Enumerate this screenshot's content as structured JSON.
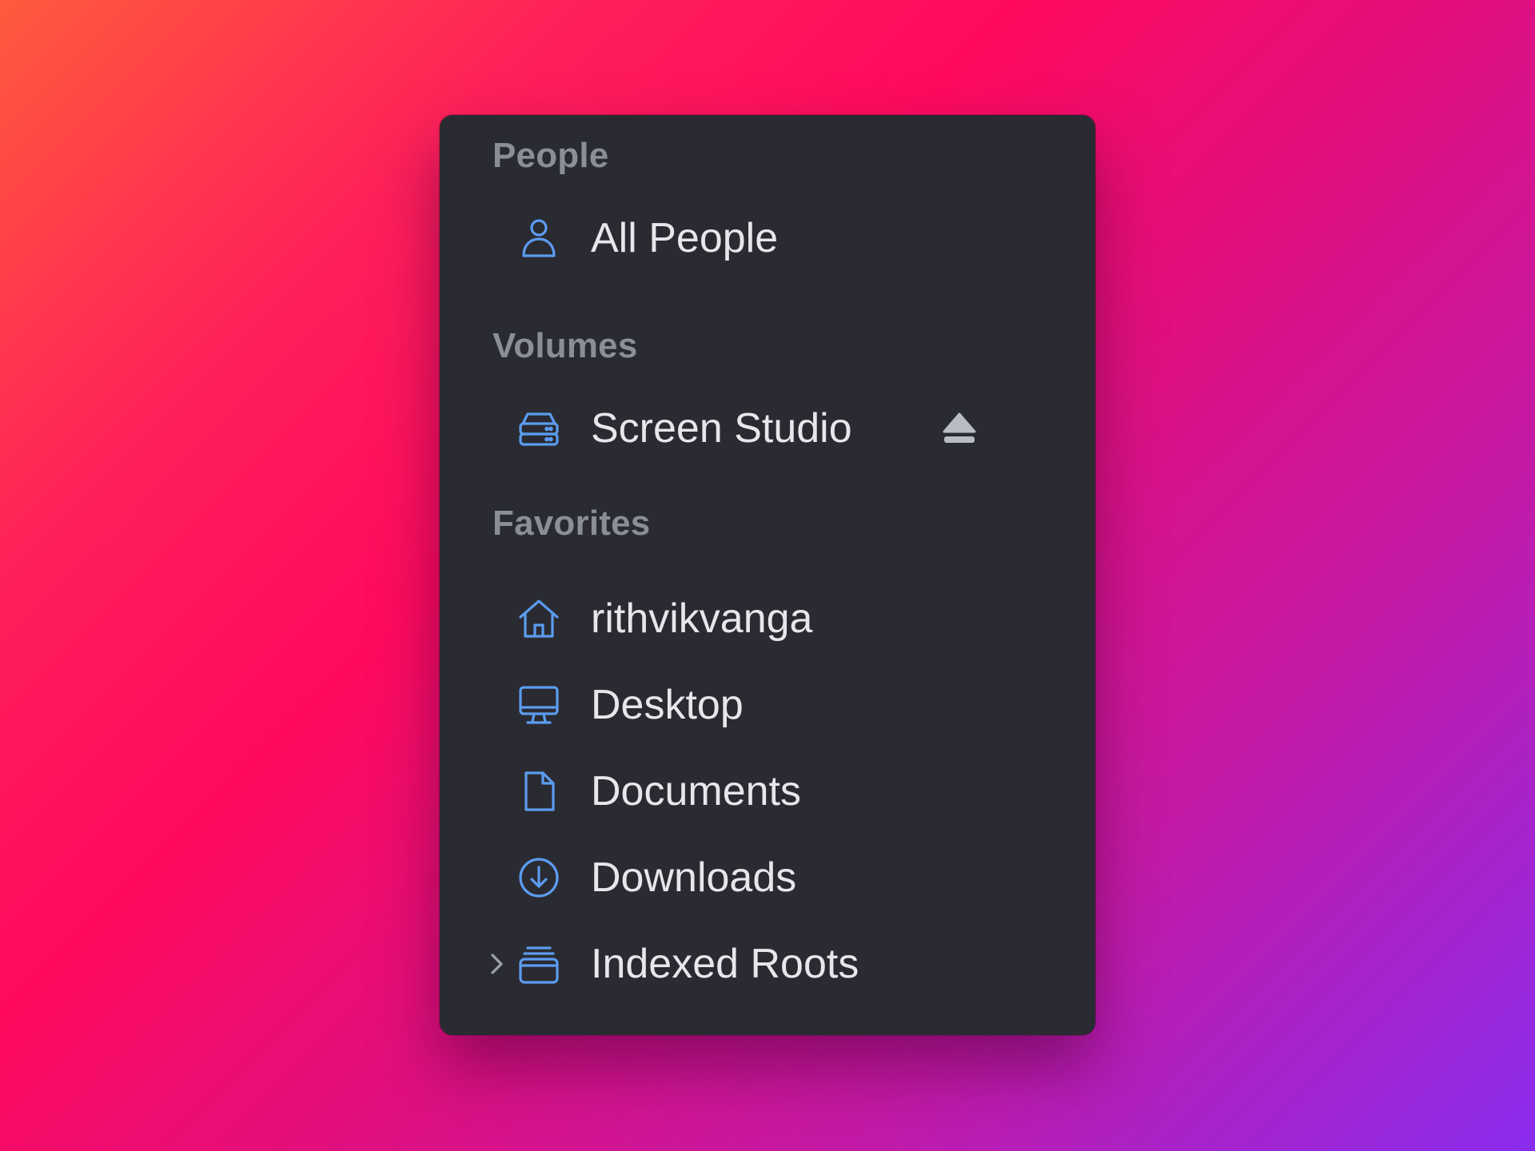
{
  "sections": {
    "people": {
      "title": "People",
      "items": [
        {
          "label": "All People",
          "icon": "person-icon"
        }
      ]
    },
    "volumes": {
      "title": "Volumes",
      "items": [
        {
          "label": "Screen Studio",
          "icon": "drive-icon",
          "action_icon": "eject-icon"
        }
      ]
    },
    "favorites": {
      "title": "Favorites",
      "items": [
        {
          "label": "rithvikvanga",
          "icon": "home-icon"
        },
        {
          "label": "Desktop",
          "icon": "desktop-icon"
        },
        {
          "label": "Documents",
          "icon": "document-icon"
        },
        {
          "label": "Downloads",
          "icon": "download-icon"
        },
        {
          "label": "Indexed Roots",
          "icon": "archive-stack-icon",
          "expandable": true
        }
      ]
    }
  },
  "colors": {
    "panel_background": "#2a2b32",
    "section_title": "#8b8e96",
    "item_label": "#e6e7ea",
    "icon_accent": "#5b9cf0",
    "eject_icon": "#b9bcc3"
  }
}
